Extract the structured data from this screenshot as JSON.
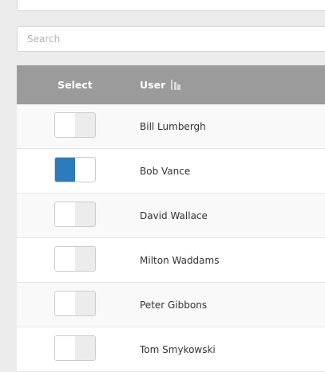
{
  "search": {
    "placeholder": "Search",
    "value": ""
  },
  "table": {
    "headers": {
      "select": "Select",
      "user": "User"
    },
    "rows": [
      {
        "name": "Bill Lumbergh",
        "selected": false
      },
      {
        "name": "Bob Vance",
        "selected": true
      },
      {
        "name": "David Wallace",
        "selected": false
      },
      {
        "name": "Milton Waddams",
        "selected": false
      },
      {
        "name": "Peter Gibbons",
        "selected": false
      },
      {
        "name": "Tom Smykowski",
        "selected": false
      }
    ]
  },
  "colors": {
    "header_bg": "#9b9b9b",
    "toggle_on": "#2b7bbd"
  },
  "icons": {
    "sort": "sort-ascending-icon"
  }
}
